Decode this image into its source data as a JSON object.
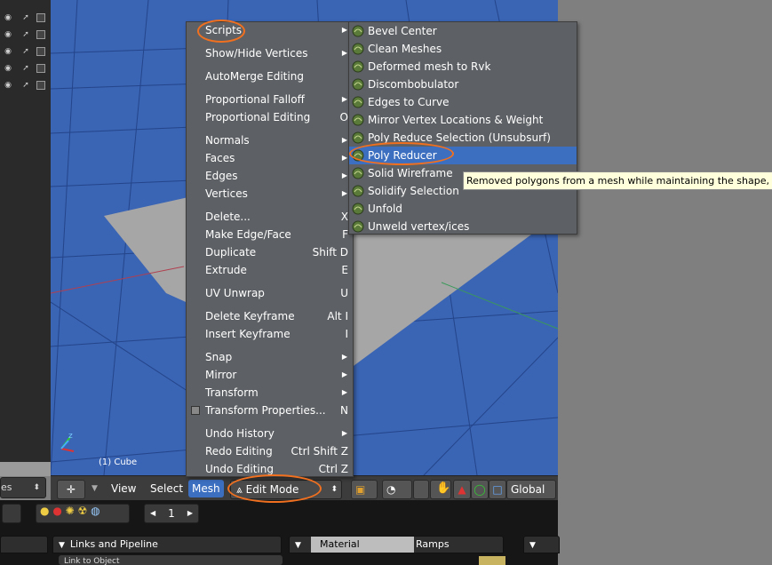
{
  "outliner": {
    "selector_text": "es"
  },
  "viewport": {
    "object_label": "(1) Cube",
    "axis_z": "z"
  },
  "header": {
    "view": "View",
    "select": "Select",
    "mesh": "Mesh",
    "mode": "Edit Mode",
    "orientation": "Global"
  },
  "buttons": {
    "frame": "1",
    "panel_links": "Links and Pipeline",
    "link_to_object": "Link to Object",
    "tab_material": "Material",
    "tab_ramps": "Ramps"
  },
  "menu": {
    "items": [
      {
        "label": "Scripts",
        "submenu": true
      },
      {
        "label": "Show/Hide Vertices",
        "submenu": true
      },
      {
        "label": "AutoMerge Editing"
      },
      {
        "label": "Proportional Falloff",
        "submenu": true
      },
      {
        "label": "Proportional Editing",
        "shortcut": "O"
      },
      {
        "label": "Normals",
        "submenu": true
      },
      {
        "label": "Faces",
        "submenu": true
      },
      {
        "label": "Edges",
        "submenu": true
      },
      {
        "label": "Vertices",
        "submenu": true
      },
      {
        "label": "Delete...",
        "shortcut": "X"
      },
      {
        "label": "Make Edge/Face",
        "shortcut": "F"
      },
      {
        "label": "Duplicate",
        "shortcut": "Shift D"
      },
      {
        "label": "Extrude",
        "shortcut": "E"
      },
      {
        "label": "UV Unwrap",
        "shortcut": "U"
      },
      {
        "label": "Delete Keyframe",
        "shortcut": "Alt I"
      },
      {
        "label": "Insert Keyframe",
        "shortcut": "I"
      },
      {
        "label": "Snap",
        "submenu": true
      },
      {
        "label": "Mirror",
        "submenu": true
      },
      {
        "label": "Transform",
        "submenu": true
      },
      {
        "label": "Transform Properties...",
        "shortcut": "N"
      },
      {
        "label": "Undo History",
        "submenu": true
      },
      {
        "label": "Redo Editing",
        "shortcut": "Ctrl Shift Z"
      },
      {
        "label": "Undo Editing",
        "shortcut": "Ctrl Z"
      }
    ]
  },
  "scripts_submenu": {
    "items": [
      "Bevel Center",
      "Clean Meshes",
      "Deformed mesh to Rvk",
      "Discombobulator",
      "Edges to Curve",
      "Mirror Vertex Locations & Weight",
      "Poly Reduce Selection (Unsubsurf)",
      "Poly Reducer",
      "Solid Wireframe",
      "Solidify Selection",
      "Unfold",
      "Unweld vertex/ices"
    ],
    "selected": "Poly Reducer"
  },
  "tooltip": "Removed polygons from a mesh while maintaining the shape,",
  "colors": {
    "viewport": "#3a64b4",
    "highlight": "#3d6fc0",
    "annotation": "#f07020",
    "tooltip_bg": "#ffffdc"
  }
}
